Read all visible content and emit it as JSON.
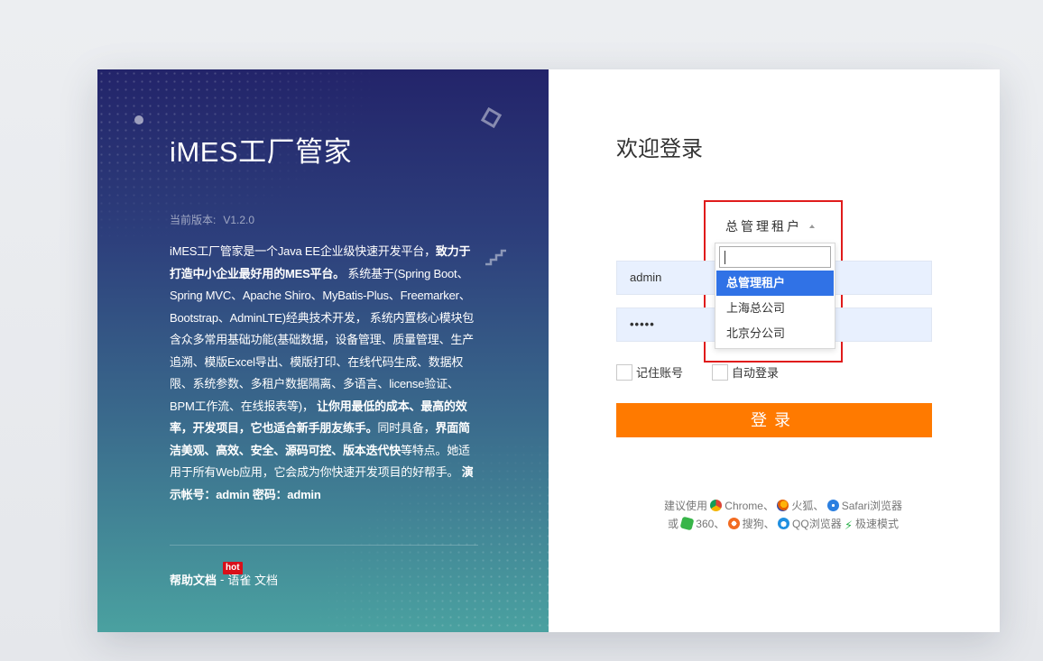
{
  "brand": {
    "title": "iMES工厂管家",
    "version_label": "当前版本:",
    "version": "V1.2.0"
  },
  "description": {
    "p1": "iMES工厂管家是一个Java EE企业级快速开发平台，",
    "b1": "致力于打造中小企业最好用的MES平台。",
    "p2": " 系统基于(Spring Boot、Spring MVC、Apache Shiro、MyBatis-Plus、Freemarker、Bootstrap、AdminLTE)经典技术开发， 系统内置核心模块包含众多常用基础功能(基础数据，设备管理、质量管理、生产追溯、模版Excel导出、模版打印、在线代码生成、数据权限、系统参数、多租户数据隔离、多语言、license验证、BPM工作流、在线报表等)，",
    "b2": " 让你用最低的成本、最高的效率，开发项目，它也适合新手朋友练手。",
    "p3": "同时具备，",
    "b3": "界面简洁美观、高效、安全、源码可控、版本迭代快",
    "p4": "等特点。她适用于所有Web应用，它会成为你快速开发项目的好帮手。",
    "b4": " 演示帐号：admin 密码：admin"
  },
  "links": {
    "help": "帮助文档",
    "hot": "hot",
    "sep": "-",
    "yuque": "语雀 文档"
  },
  "login": {
    "welcome": "欢迎登录",
    "tenant_selected": "总管理租户",
    "tenant_options": [
      "总管理租户",
      "上海总公司",
      "北京分公司"
    ],
    "username": "admin",
    "password_mask": "•••••",
    "remember_label": "记住账号",
    "auto_login_label": "自动登录",
    "submit_label": "登录"
  },
  "browser_tip": {
    "prefix": "建议使用",
    "chrome": "Chrome、",
    "firefox": "火狐、",
    "safari": "Safari浏览器",
    "or": "或",
    "b360": "360、",
    "sogou": "搜狗、",
    "qq": "QQ浏览器",
    "speed": "极速模式"
  },
  "colors": {
    "accent_orange": "#ff7a00",
    "highlight_red": "#e01b1b",
    "option_active": "#3072e6",
    "panel_top": "#23246a",
    "panel_bottom": "#4aa1a0"
  }
}
